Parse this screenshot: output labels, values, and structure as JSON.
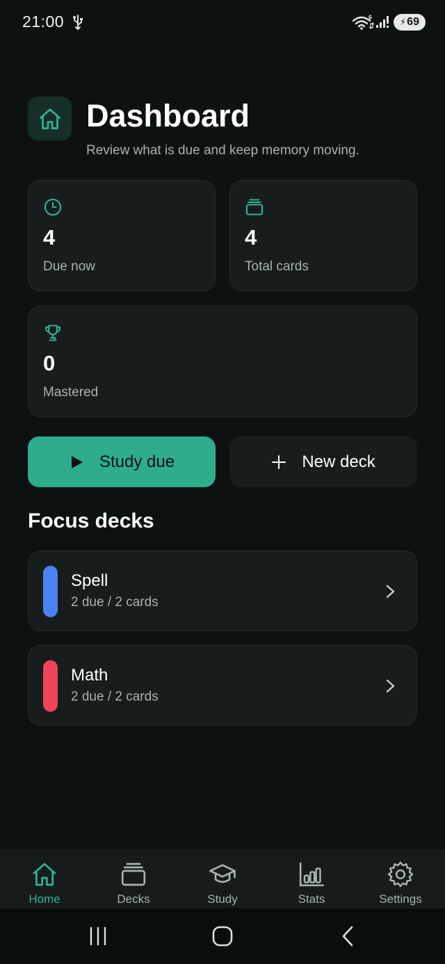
{
  "status_bar": {
    "time": "21:00",
    "wifi_badge": "6",
    "battery_level": "69",
    "icons": [
      "usb-icon",
      "wifi-icon",
      "signal-icon",
      "battery-icon"
    ]
  },
  "header": {
    "icon": "home-icon",
    "title": "Dashboard",
    "subtitle": "Review what is due and keep memory moving."
  },
  "stats": [
    {
      "icon": "clock-icon",
      "value": "4",
      "label": "Due now"
    },
    {
      "icon": "cards-icon",
      "value": "4",
      "label": "Total cards"
    },
    {
      "icon": "trophy-icon",
      "value": "0",
      "label": "Mastered"
    }
  ],
  "actions": {
    "study_due": {
      "label": "Study due",
      "icon": "play-icon"
    },
    "new_deck": {
      "label": "New deck",
      "icon": "plus-icon"
    }
  },
  "focus": {
    "title": "Focus decks",
    "decks": [
      {
        "name": "Spell",
        "meta": "2 due / 2 cards",
        "color": "#4a82f2"
      },
      {
        "name": "Math",
        "meta": "2 due / 2 cards",
        "color": "#ef4458"
      }
    ]
  },
  "nav": {
    "active": "Home",
    "items": [
      {
        "label": "Home",
        "icon": "home-icon"
      },
      {
        "label": "Decks",
        "icon": "cards-icon"
      },
      {
        "label": "Study",
        "icon": "graduation-cap-icon"
      },
      {
        "label": "Stats",
        "icon": "bar-chart-icon"
      },
      {
        "label": "Settings",
        "icon": "gear-icon"
      }
    ]
  },
  "colors": {
    "accent": "#2fab8e",
    "background": "#0d1111",
    "card": "#161d1c",
    "muted_text": "#a8b3b1"
  }
}
